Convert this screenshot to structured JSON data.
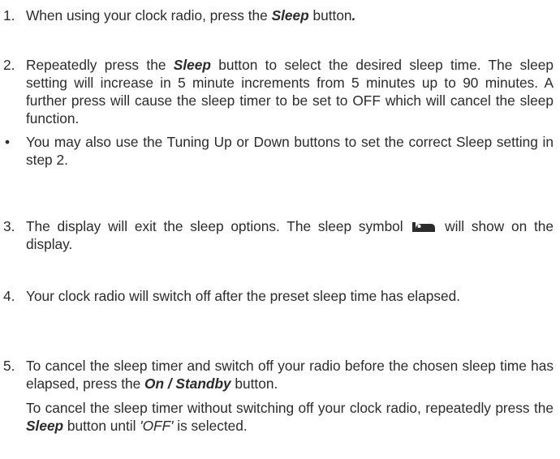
{
  "steps": [
    {
      "number": "1.",
      "parts": [
        "When using your clock radio, press the ",
        "Sleep",
        " button",
        "."
      ]
    },
    {
      "number": "2.",
      "parts": [
        "Repeatedly press the ",
        "Sleep",
        " button to select the desired sleep time. The sleep setting will increase in 5 minute increments from 5 minutes up to 90 minutes. A further press will cause the sleep timer to be set to OFF which will cancel the sleep function."
      ]
    },
    {
      "bullet": "•",
      "text": "You may also use the Tuning Up or Down buttons to set the correct Sleep setting in step 2."
    },
    {
      "number": "3.",
      "parts": [
        "The display will exit the sleep options. The sleep symbol ",
        " will show on the display."
      ],
      "icon": "sleep-symbol-icon"
    },
    {
      "number": "4.",
      "text": "Your clock radio will switch off after the preset sleep time has elapsed."
    },
    {
      "number": "5.",
      "para1": [
        "To cancel the sleep timer and switch off your radio before the chosen sleep time has elapsed, press the ",
        "On / Standby",
        " button."
      ],
      "para2": [
        "To cancel the sleep timer without switching off your clock radio, repeatedly press the ",
        "Sleep",
        " button until ",
        "'OFF'",
        " is selected."
      ]
    }
  ]
}
